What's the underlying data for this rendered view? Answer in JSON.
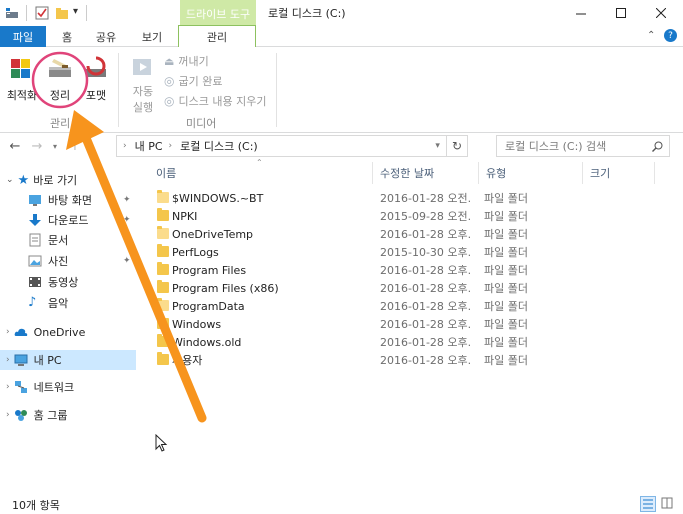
{
  "title_bar": {
    "context_tab": "드라이브 도구",
    "window_title": "로컬 디스크 (C:)",
    "qa_dropdown": "▾"
  },
  "ribbon_tabs": [
    "파일",
    "홈",
    "공유",
    "보기",
    "관리"
  ],
  "ribbon": {
    "optimize": "최적화",
    "cleanup": "정리",
    "format": "포맷",
    "group_manage": "관리",
    "autoplay_line1": "자동",
    "autoplay_line2": "실행",
    "eject": "꺼내기",
    "finish_burn": "굽기 완료",
    "erase_disc": "디스크 내용 지우기",
    "group_media": "미디어"
  },
  "address": {
    "path_pc": "내 PC",
    "path_drive": "로컬 디스크 (C:)",
    "search_placeholder": "로컬 디스크 (C:) 검색"
  },
  "nav": {
    "quick_access": "바로 가기",
    "desktop": "바탕 화면",
    "downloads": "다운로드",
    "documents": "문서",
    "pictures": "사진",
    "videos": "동영상",
    "music": "음악",
    "onedrive": "OneDrive",
    "this_pc": "내 PC",
    "network": "네트워크",
    "homegroup": "홈 그룹"
  },
  "columns": {
    "name": "이름",
    "modified": "수정한 날짜",
    "type": "유형",
    "size": "크기"
  },
  "files": [
    {
      "name": "$WINDOWS.~BT",
      "date": "2016-01-28 오전...",
      "type": "파일 폴더"
    },
    {
      "name": "NPKI",
      "date": "2015-09-28 오전...",
      "type": "파일 폴더"
    },
    {
      "name": "OneDriveTemp",
      "date": "2016-01-28 오후...",
      "type": "파일 폴더"
    },
    {
      "name": "PerfLogs",
      "date": "2015-10-30 오후...",
      "type": "파일 폴더"
    },
    {
      "name": "Program Files",
      "date": "2016-01-28 오후...",
      "type": "파일 폴더"
    },
    {
      "name": "Program Files (x86)",
      "date": "2016-01-28 오후...",
      "type": "파일 폴더"
    },
    {
      "name": "ProgramData",
      "date": "2016-01-28 오후...",
      "type": "파일 폴더"
    },
    {
      "name": "Windows",
      "date": "2016-01-28 오후...",
      "type": "파일 폴더"
    },
    {
      "name": "Windows.old",
      "date": "2016-01-28 오후...",
      "type": "파일 폴더"
    },
    {
      "name": "사용자",
      "date": "2016-01-28 오후...",
      "type": "파일 폴더"
    }
  ],
  "status": {
    "item_count": "10개 항목"
  },
  "colors": {
    "accent": "#1979ca",
    "context_tab": "#cfe9a6",
    "annotation_circle": "#e0447a",
    "annotation_arrow": "#f7941d",
    "selected_nav": "#cce8ff"
  }
}
